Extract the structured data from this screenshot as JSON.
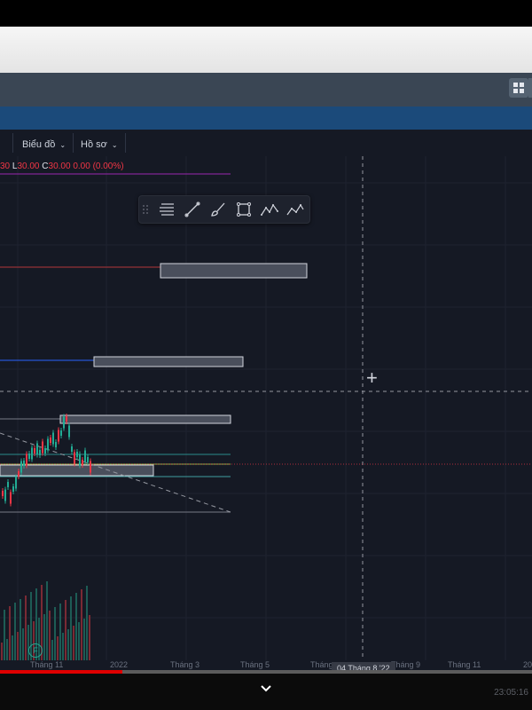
{
  "menu": {
    "items": [
      "Biểu đồ",
      "Hồ sơ"
    ]
  },
  "ohlc": {
    "partial_value": "30",
    "low_label": "L",
    "low_value": "30.00",
    "close_label": "C",
    "close_value": "30.00",
    "change": "0.00 (0.00%)"
  },
  "toolbar": {
    "icons": [
      "drag-handle-icon",
      "horizontal-lines-icon",
      "trendline-icon",
      "brush-icon",
      "rectangle-icon",
      "pattern-xabcd-icon",
      "pattern-abc-icon"
    ]
  },
  "axis": {
    "labels": [
      "Tháng 11",
      "2022",
      "Tháng 3",
      "Tháng 5",
      "Tháng",
      "Tháng 9",
      "Tháng 11",
      "20"
    ],
    "crosshair_date": "04 Tháng 8 '22"
  },
  "player": {
    "progress": 0.23,
    "timestamp": "23:05:16"
  },
  "chart_marker": "F",
  "colors": {
    "background": "#151924",
    "up": "#22ab94",
    "down": "#f23645",
    "header": "#3a4654",
    "blue_bar": "#1b4a7a"
  }
}
